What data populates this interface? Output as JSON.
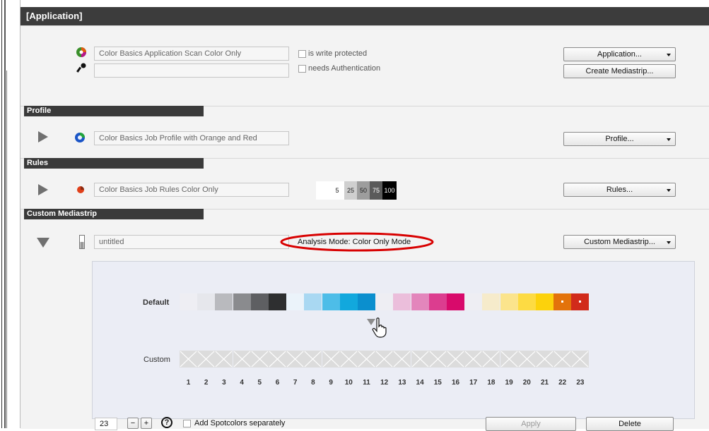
{
  "window": {
    "title": "[Application]"
  },
  "application": {
    "name_value": "Color Basics Application Scan Color Only",
    "password_value": "",
    "write_protected_label": "is write protected",
    "needs_auth_label": "needs Authentication",
    "application_button": "Application...",
    "create_mediastrip_button": "Create Mediastrip..."
  },
  "profile": {
    "section_title": "Profile",
    "value": "Color Basics Job Profile with Orange and Red",
    "button": "Profile..."
  },
  "rules": {
    "section_title": "Rules",
    "value": "Color Basics Job Rules Color Only",
    "button": "Rules...",
    "scale": [
      "",
      "5",
      "25",
      "50",
      "75",
      "100"
    ]
  },
  "custom_mediastrip": {
    "section_title": "Custom Mediastrip",
    "name_value": "untitled",
    "analysis_mode": "Analysis Mode: Color Only Mode",
    "button": "Custom Mediastrip..."
  },
  "strip": {
    "default_label": "Default",
    "custom_label": "Custom",
    "default_patches": [
      "#eeeef3",
      "#e6e7ec",
      "#b9babe",
      "#8a8b8e",
      "#5e5f62",
      "#2e2f30",
      "#ebf3fa",
      "#a9d8f2",
      "#4dbde8",
      "#12a8dd",
      "#0b8fce",
      "#eeeef3",
      "#ebbedb",
      "#e386bc",
      "#dc3d8f",
      "#d80a6b",
      "#eeeef3",
      "#f6ebcb",
      "#fbe48c",
      "#fddb43",
      "#fcd20c",
      "#e3730b",
      "#d12b1b"
    ],
    "numbers": [
      "1",
      "2",
      "3",
      "4",
      "5",
      "6",
      "7",
      "8",
      "9",
      "10",
      "11",
      "12",
      "13",
      "14",
      "15",
      "16",
      "17",
      "18",
      "19",
      "20",
      "21",
      "22",
      "23"
    ]
  },
  "footer": {
    "count_value": "23",
    "minus": "−",
    "plus": "+",
    "help": "?",
    "spotcolors_label": "Add Spotcolors separately",
    "apply_button": "Apply",
    "delete_button": "Delete"
  },
  "colors": {
    "accent_red": "#d80000",
    "title_bg": "#3c3c3c"
  }
}
